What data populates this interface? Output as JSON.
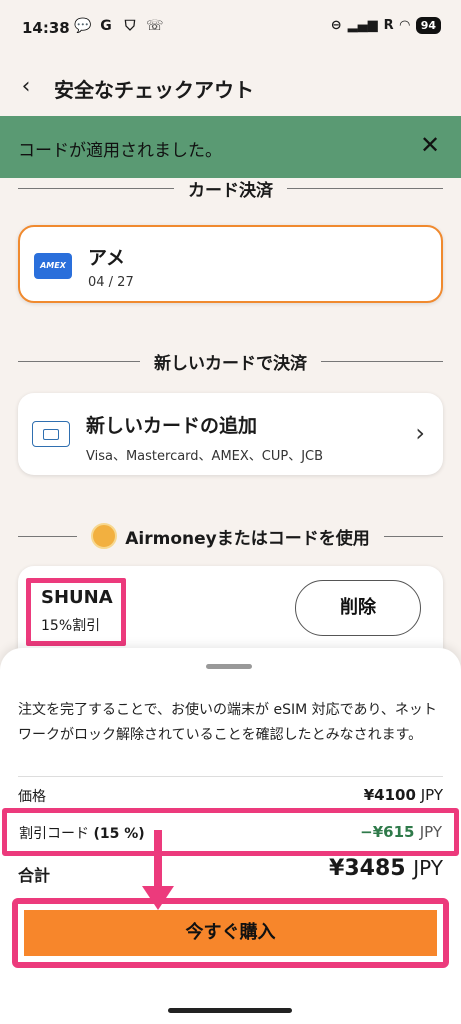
{
  "status_bar": {
    "time": "14:38",
    "left_icons": [
      "chat-icon",
      "google-icon",
      "shield-icon",
      "call-icon"
    ],
    "right_icons": [
      "dnd-icon",
      "signal-icon",
      "roaming-r",
      "wifi-icon"
    ],
    "roaming": "R",
    "battery": "94"
  },
  "header": {
    "title": "安全なチェックアウト"
  },
  "toast": {
    "message": "コードが適用されました。"
  },
  "card_section": {
    "title": "カード決済",
    "saved_card": {
      "brand_logo": "AMEX",
      "name": "アメ",
      "expiry": "04 / 27"
    }
  },
  "new_card_section": {
    "title": "新しいカードで決済",
    "add_title": "新しいカードの追加",
    "add_subtitle": "Visa、Mastercard、AMEX、CUP、JCB"
  },
  "code_section": {
    "title": "Airmoneyまたはコードを使用",
    "code_name": "SHUNA",
    "code_discount": "15%割引",
    "remove_label": "削除"
  },
  "sheet": {
    "disclaimer": "注文を完了することで、お使いの端末が eSIM 対応であり、ネットワークがロック解除されていることを確認したとみなされます。",
    "price_label": "価格",
    "price_value": "¥4100",
    "price_currency": "JPY",
    "discount_label": "割引コード",
    "discount_percent": "(15 %)",
    "discount_value": "−¥615",
    "discount_currency": "JPY",
    "total_label": "合計",
    "total_value": "¥3485",
    "total_currency": "JPY",
    "buy_label": "今すぐ購入"
  },
  "colors": {
    "accent_orange": "#f7862b",
    "toast_green": "#5a9a73",
    "highlight_pink": "#ec3a7c",
    "discount_green": "#2f7a4a"
  }
}
